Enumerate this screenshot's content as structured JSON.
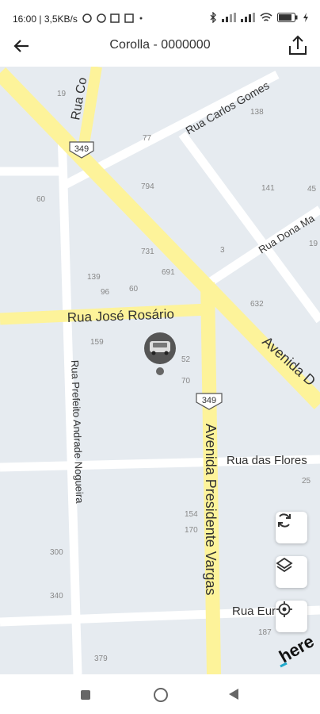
{
  "status_bar": {
    "time_info": "16:00 | 3,5KB/s",
    "battery": "82"
  },
  "app_bar": {
    "title": "Corolla - 0000000"
  },
  "map": {
    "streets": {
      "rua_co": "Rua Co",
      "carlos_gomes": "Rua Carlos Gomes",
      "dona_ma": "Rua Dona Ma",
      "jose_rosario": "Rua José Rosário",
      "avenida_d": "Avenida D",
      "prefeito": "Rua Prefeito Andrade Nogueira",
      "das_flores": "Rua das Flores",
      "presidente_vargas": "Avenida Presidente Vargas",
      "rua_eur": "Rua Eur"
    },
    "route_shields": [
      "349",
      "349"
    ],
    "house_numbers": [
      "19",
      "77",
      "138",
      "60",
      "794",
      "141",
      "45",
      "731",
      "3",
      "691",
      "139",
      "96",
      "60",
      "632",
      "159",
      "52",
      "70",
      "25",
      "154",
      "170",
      "300",
      "340",
      "187",
      "379",
      "19"
    ],
    "logo": "here"
  },
  "icons": {
    "back": "arrow-left-icon",
    "share": "share-icon",
    "refresh": "refresh-icon",
    "layers": "layers-icon",
    "locate": "locate-icon",
    "vehicle": "car-icon"
  }
}
